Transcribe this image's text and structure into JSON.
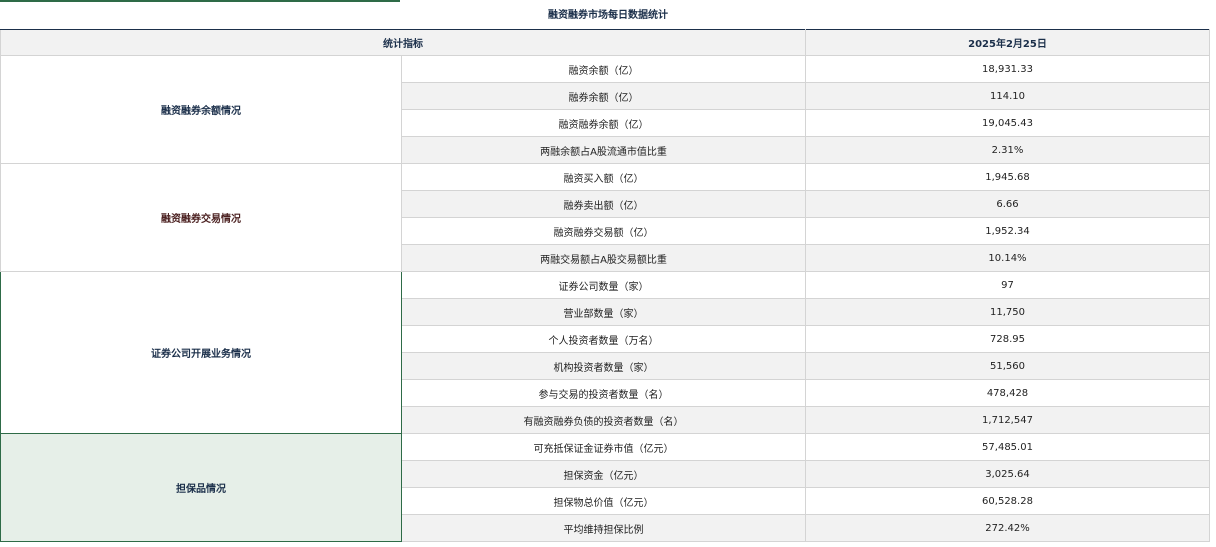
{
  "title": "融资融券市场每日数据统计",
  "header": {
    "indicator_label": "统计指标",
    "date_label": "2025年2月25日"
  },
  "groups": [
    {
      "name": "融资融券余额情况",
      "rows": [
        {
          "metric": "融资余额（亿）",
          "value": "18,931.33"
        },
        {
          "metric": "融券余额（亿）",
          "value": "114.10"
        },
        {
          "metric": "融资融券余额（亿）",
          "value": "19,045.43"
        },
        {
          "metric": "两融余额占A股流通市值比重",
          "value": "2.31%"
        }
      ]
    },
    {
      "name": "融资融券交易情况",
      "rows": [
        {
          "metric": "融资买入额（亿）",
          "value": "1,945.68"
        },
        {
          "metric": "融券卖出额（亿）",
          "value": "6.66"
        },
        {
          "metric": "融资融券交易额（亿）",
          "value": "1,952.34"
        },
        {
          "metric": "两融交易额占A股交易额比重",
          "value": "10.14%"
        }
      ]
    },
    {
      "name": "证券公司开展业务情况",
      "rows": [
        {
          "metric": "证券公司数量（家）",
          "value": "97"
        },
        {
          "metric": "营业部数量（家）",
          "value": "11,750"
        },
        {
          "metric": "个人投资者数量（万名）",
          "value": "728.95"
        },
        {
          "metric": "机构投资者数量（家）",
          "value": "51,560"
        },
        {
          "metric": "参与交易的投资者数量（名）",
          "value": "478,428"
        },
        {
          "metric": "有融资融券负债的投资者数量（名）",
          "value": "1,712,547"
        }
      ]
    },
    {
      "name": "担保品情况",
      "rows": [
        {
          "metric": "可充抵保证金证券市值（亿元）",
          "value": "57,485.01"
        },
        {
          "metric": "担保资金（亿元）",
          "value": "3,025.64"
        },
        {
          "metric": "担保物总价值（亿元）",
          "value": "60,528.28"
        },
        {
          "metric": "平均维持担保比例",
          "value": "272.42%"
        }
      ]
    }
  ]
}
